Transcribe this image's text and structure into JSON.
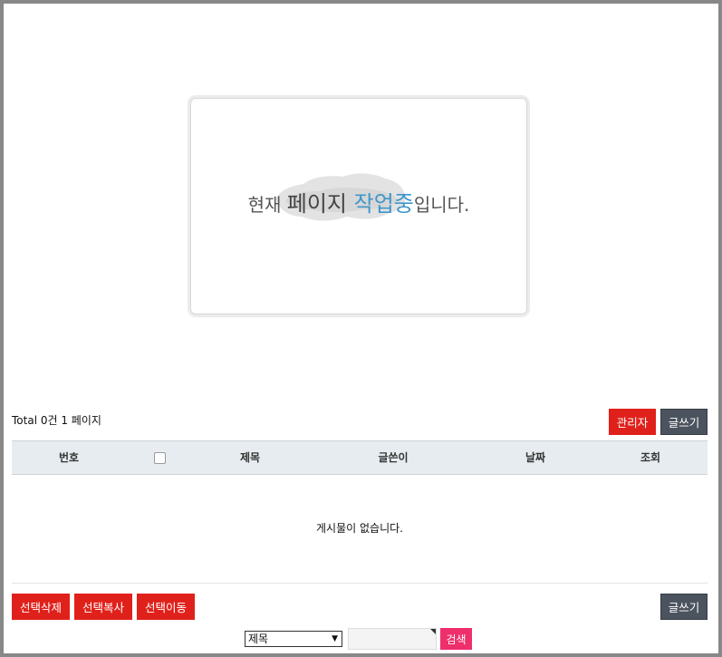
{
  "notice": {
    "part1": "현재 ",
    "part2": "페이지 ",
    "part3": "작업중",
    "part4": "입니다."
  },
  "board": {
    "total_label": "Total 0건 1 페이지",
    "admin_button": "관리자",
    "write_button": "글쓰기",
    "columns": [
      "번호",
      "제목",
      "글쓴이",
      "날짜",
      "조회"
    ],
    "empty_message": "게시물이 없습니다."
  },
  "bottom": {
    "delete_selected": "선택삭제",
    "copy_selected": "선택복사",
    "move_selected": "선택이동",
    "write_button": "글쓰기"
  },
  "search": {
    "field_selected": "제목",
    "query_value": "",
    "search_button": "검색"
  },
  "colors": {
    "accent_red": "#e0211b",
    "dark_button": "#4b535e",
    "search_pink": "#ee2f6c",
    "table_header": "#e6ecf0",
    "notice_blue": "#3f97cb"
  }
}
